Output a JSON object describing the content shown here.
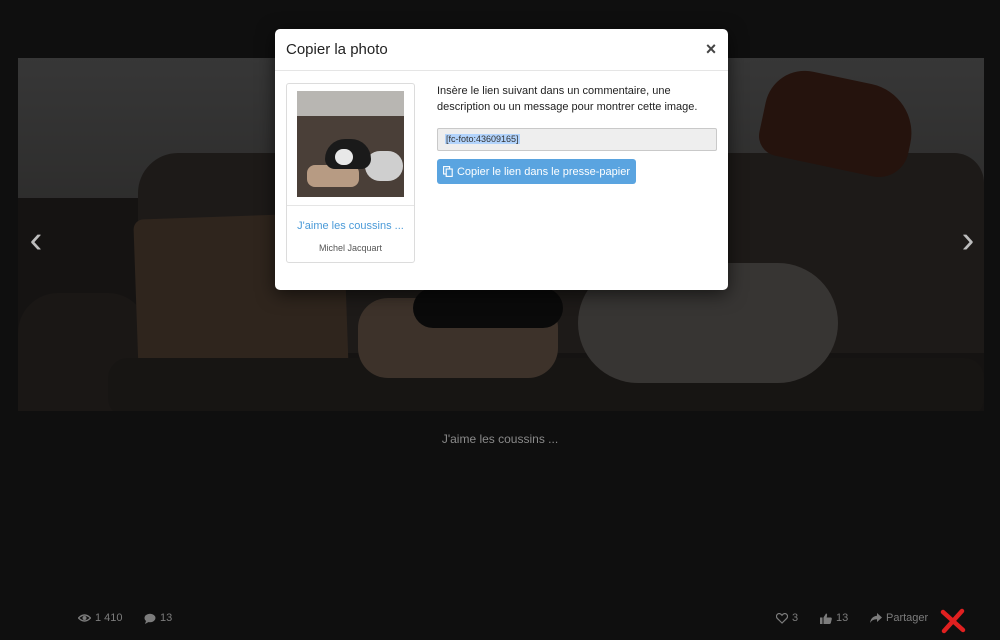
{
  "modal": {
    "title": "Copier la photo",
    "close_label": "×",
    "instruction": "Insère le lien suivant dans un commentaire, une description ou un message pour montrer cette image.",
    "link_value": "[fc-foto:43609165]",
    "copy_button_label": "Copier le lien dans le presse-papier",
    "thumbnail": {
      "title": "J'aime les coussins ...",
      "author": "Michel Jacquart"
    }
  },
  "photo": {
    "caption": "J'aime les coussins ..."
  },
  "nav": {
    "prev_glyph": "‹",
    "next_glyph": "›"
  },
  "stats": {
    "views": "1 410",
    "comments": "13",
    "likes": "3",
    "thumbs": "13",
    "share_label": "Partager"
  },
  "icons": {
    "views": "eye-icon",
    "comments": "comment-icon",
    "likes": "heart-icon",
    "thumbs": "thumbs-up-icon",
    "share": "share-icon",
    "close": "close-x-icon"
  },
  "colors": {
    "accent": "#5aa4e0",
    "link": "#4a9ad8",
    "close_x": "#e02020"
  }
}
